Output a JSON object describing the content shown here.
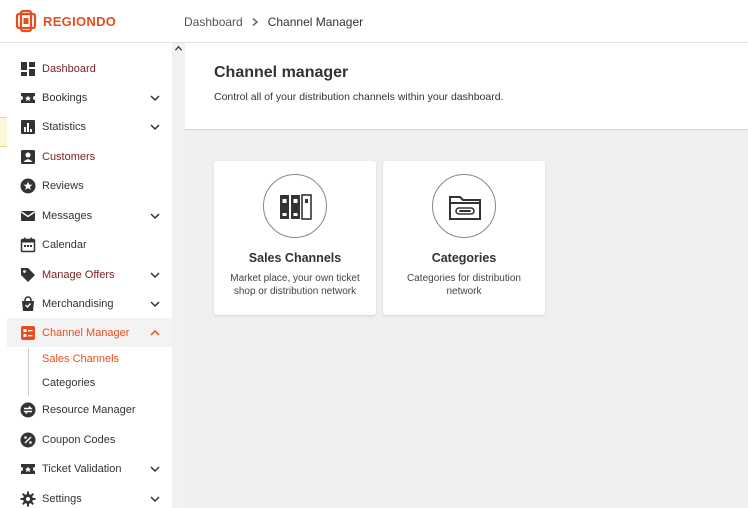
{
  "brand": {
    "name": "REGIONDO",
    "accent": "#e84d1c"
  },
  "breadcrumb": {
    "parent": "Dashboard",
    "current": "Channel Manager"
  },
  "sidebar": {
    "items": [
      {
        "label": "Dashboard",
        "icon": "dashboard-icon"
      },
      {
        "label": "Bookings",
        "icon": "ticket-icon"
      },
      {
        "label": "Statistics",
        "icon": "bar-chart-icon"
      },
      {
        "label": "Customers",
        "icon": "contact-card-icon"
      },
      {
        "label": "Reviews",
        "icon": "star-circle-icon"
      },
      {
        "label": "Messages",
        "icon": "mail-icon"
      },
      {
        "label": "Calendar",
        "icon": "calendar-icon"
      },
      {
        "label": "Manage Offers",
        "icon": "tag-icon"
      },
      {
        "label": "Merchandising",
        "icon": "shopping-bag-icon"
      },
      {
        "label": "Channel Manager",
        "icon": "channel-manager-icon"
      },
      {
        "label": "Resource Manager",
        "icon": "swap-icon"
      },
      {
        "label": "Coupon Codes",
        "icon": "coupon-icon"
      },
      {
        "label": "Ticket Validation",
        "icon": "ticket-icon"
      },
      {
        "label": "Settings",
        "icon": "gear-icon"
      }
    ],
    "subitems": [
      {
        "label": "Sales Channels"
      },
      {
        "label": "Categories"
      }
    ]
  },
  "page": {
    "title": "Channel manager",
    "subtitle": "Control all of your distribution channels within your dashboard."
  },
  "cards": [
    {
      "title": "Sales Channels",
      "desc": "Market place, your own ticket shop or distribution network",
      "icon": "binders-icon"
    },
    {
      "title": "Categories",
      "desc": "Categories for distribution network",
      "icon": "folder-icon"
    }
  ]
}
